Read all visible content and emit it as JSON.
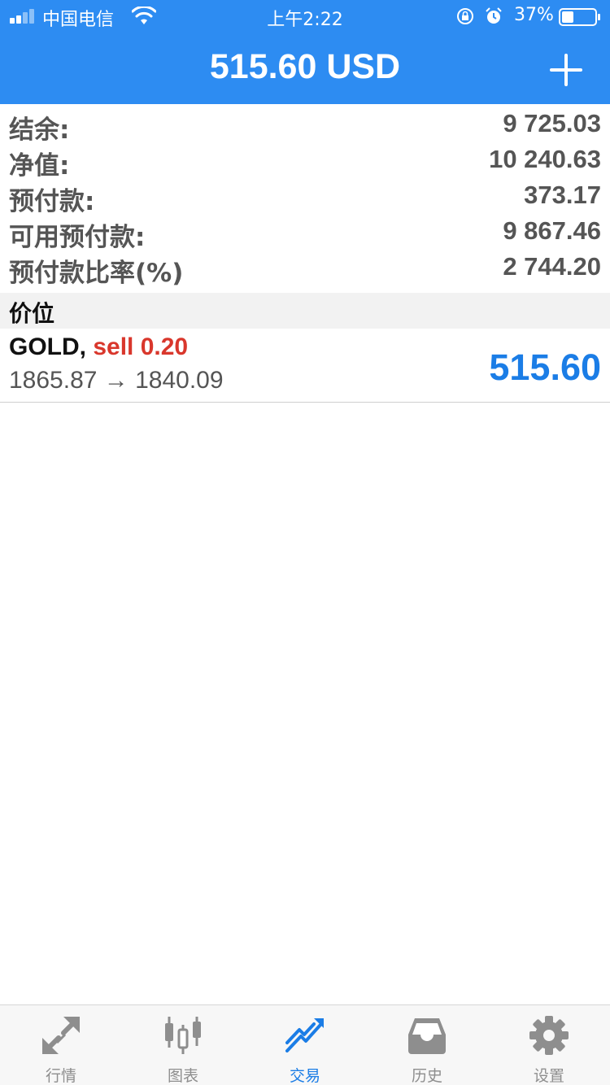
{
  "status_bar": {
    "carrier": "中国电信",
    "time": "上午2:22",
    "battery_percent": "37%",
    "battery_level": 0.37,
    "signal_bars_filled": 2,
    "signal_bars_total": 4
  },
  "header": {
    "title": "515.60 USD",
    "add_icon": "plus-icon"
  },
  "summary": [
    {
      "label": "结余:",
      "value": "9 725.03"
    },
    {
      "label": "净值:",
      "value": "10 240.63"
    },
    {
      "label": "预付款:",
      "value": "373.17"
    },
    {
      "label": "可用预付款:",
      "value": "9 867.46"
    },
    {
      "label": "预付款比率(%)",
      "value": "2 744.20"
    }
  ],
  "positions_section": {
    "title": "价位",
    "items": [
      {
        "symbol": "GOLD,",
        "direction": "sell 0.20",
        "prices": "1865.87 → 1840.09",
        "profit": "515.60"
      }
    ]
  },
  "tabs": [
    {
      "label": "行情",
      "icon": "quotes-arrows-icon",
      "active": false
    },
    {
      "label": "图表",
      "icon": "candlestick-chart-icon",
      "active": false
    },
    {
      "label": "交易",
      "icon": "trade-trend-icon",
      "active": true
    },
    {
      "label": "历史",
      "icon": "history-tray-icon",
      "active": false
    },
    {
      "label": "设置",
      "icon": "settings-gear-icon",
      "active": false
    }
  ],
  "colors": {
    "header_bg": "#2d8cf2",
    "sell": "#d9372c",
    "profit": "#1b7de6",
    "tab_active": "#1b7de6",
    "tab_inactive": "#8e8e8e"
  }
}
